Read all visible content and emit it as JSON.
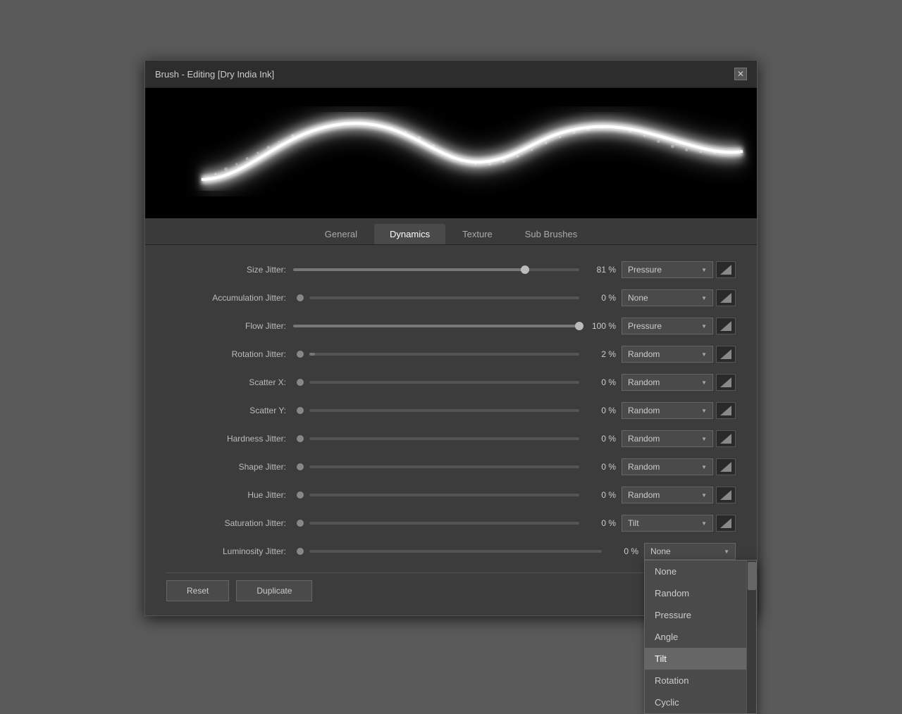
{
  "dialog": {
    "title": "Brush - Editing [Dry India Ink]",
    "close_label": "✕"
  },
  "tabs": [
    {
      "id": "general",
      "label": "General",
      "active": false
    },
    {
      "id": "dynamics",
      "label": "Dynamics",
      "active": true
    },
    {
      "id": "texture",
      "label": "Texture",
      "active": false
    },
    {
      "id": "sub-brushes",
      "label": "Sub Brushes",
      "active": false
    }
  ],
  "rows": [
    {
      "id": "size-jitter",
      "label": "Size Jitter:",
      "has_slider": true,
      "slider_pct": 81,
      "value": "81 %",
      "dropdown": "Pressure",
      "has_graph": true
    },
    {
      "id": "accumulation-jitter",
      "label": "Accumulation Jitter:",
      "has_slider": false,
      "slider_pct": 0,
      "value": "0 %",
      "dropdown": "None",
      "has_graph": true
    },
    {
      "id": "flow-jitter",
      "label": "Flow Jitter:",
      "has_slider": true,
      "slider_pct": 100,
      "value": "100 %",
      "dropdown": "Pressure",
      "has_graph": true
    },
    {
      "id": "rotation-jitter",
      "label": "Rotation Jitter:",
      "has_slider": false,
      "slider_pct": 2,
      "value": "2 %",
      "dropdown": "Random",
      "has_graph": true
    },
    {
      "id": "scatter-x",
      "label": "Scatter X:",
      "has_slider": false,
      "slider_pct": 0,
      "value": "0 %",
      "dropdown": "Random",
      "has_graph": true
    },
    {
      "id": "scatter-y",
      "label": "Scatter Y:",
      "has_slider": false,
      "slider_pct": 0,
      "value": "0 %",
      "dropdown": "Random",
      "has_graph": true
    },
    {
      "id": "hardness-jitter",
      "label": "Hardness Jitter:",
      "has_slider": false,
      "slider_pct": 0,
      "value": "0 %",
      "dropdown": "Random",
      "has_graph": true
    },
    {
      "id": "shape-jitter",
      "label": "Shape Jitter:",
      "has_slider": false,
      "slider_pct": 0,
      "value": "0 %",
      "dropdown": "Random",
      "has_graph": true
    },
    {
      "id": "hue-jitter",
      "label": "Hue Jitter:",
      "has_slider": false,
      "slider_pct": 0,
      "value": "0 %",
      "dropdown": "Random",
      "has_graph": true
    },
    {
      "id": "saturation-jitter",
      "label": "Saturation Jitter:",
      "has_slider": false,
      "slider_pct": 0,
      "value": "0 %",
      "dropdown": "Tilt",
      "has_graph": true
    },
    {
      "id": "luminosity-jitter",
      "label": "Luminosity Jitter:",
      "has_slider": false,
      "slider_pct": 0,
      "value": "0 %",
      "dropdown": "None",
      "has_graph": false
    }
  ],
  "dropdown_menu": {
    "visible": true,
    "row": "luminosity-jitter",
    "items": [
      {
        "id": "none",
        "label": "None",
        "selected": false
      },
      {
        "id": "random",
        "label": "Random",
        "selected": false
      },
      {
        "id": "pressure",
        "label": "Pressure",
        "selected": false
      },
      {
        "id": "angle",
        "label": "Angle",
        "selected": false
      },
      {
        "id": "tilt",
        "label": "Tilt",
        "selected": true
      },
      {
        "id": "rotation",
        "label": "Rotation",
        "selected": false
      },
      {
        "id": "cyclic",
        "label": "Cyclic",
        "selected": false
      }
    ]
  },
  "footer": {
    "reset_label": "Reset",
    "duplicate_label": "Duplicate"
  }
}
